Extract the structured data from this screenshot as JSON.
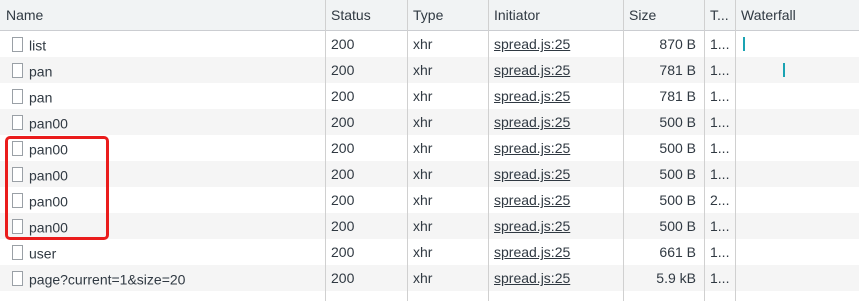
{
  "columns": {
    "name": "Name",
    "status": "Status",
    "type": "Type",
    "initiator": "Initiator",
    "size": "Size",
    "time": "T...",
    "waterfall": "Waterfall"
  },
  "rows": [
    {
      "name": "list",
      "status": "200",
      "type": "xhr",
      "initiator": "spread.js:25",
      "size": "870 B",
      "time": "1..."
    },
    {
      "name": "pan",
      "status": "200",
      "type": "xhr",
      "initiator": "spread.js:25",
      "size": "781 B",
      "time": "1..."
    },
    {
      "name": "pan",
      "status": "200",
      "type": "xhr",
      "initiator": "spread.js:25",
      "size": "781 B",
      "time": "1..."
    },
    {
      "name": "pan00",
      "status": "200",
      "type": "xhr",
      "initiator": "spread.js:25",
      "size": "500 B",
      "time": "1..."
    },
    {
      "name": "pan00",
      "status": "200",
      "type": "xhr",
      "initiator": "spread.js:25",
      "size": "500 B",
      "time": "1..."
    },
    {
      "name": "pan00",
      "status": "200",
      "type": "xhr",
      "initiator": "spread.js:25",
      "size": "500 B",
      "time": "1..."
    },
    {
      "name": "pan00",
      "status": "200",
      "type": "xhr",
      "initiator": "spread.js:25",
      "size": "500 B",
      "time": "2..."
    },
    {
      "name": "pan00",
      "status": "200",
      "type": "xhr",
      "initiator": "spread.js:25",
      "size": "500 B",
      "time": "1..."
    },
    {
      "name": "user",
      "status": "200",
      "type": "xhr",
      "initiator": "spread.js:25",
      "size": "661 B",
      "time": "1..."
    },
    {
      "name": "page?current=1&size=20",
      "status": "200",
      "type": "xhr",
      "initiator": "spread.js:25",
      "size": "5.9 kB",
      "time": "1..."
    }
  ],
  "colors": {
    "waterfall_bar": "#1aa3b3",
    "highlight_box": "#ea1c1c",
    "header_bg": "#f1f3f4",
    "row_alt_bg": "#f5f5f5"
  }
}
